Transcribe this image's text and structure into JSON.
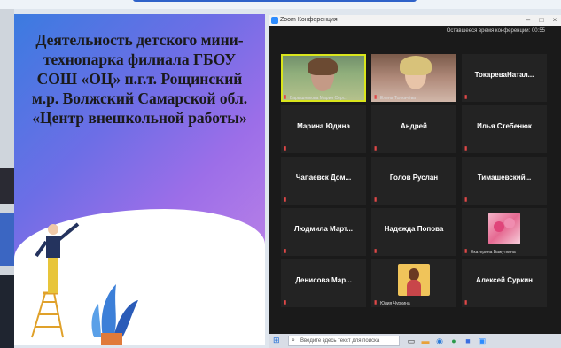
{
  "slide": {
    "title": "Деятельность детского мини-технопарка филиала ГБОУ СОШ «ОЦ» п.г.т. Рощинский м.р. Волжский Самарской обл. «Центр внешкольной работы»"
  },
  "zoom": {
    "window_title": "Zoom Конференция",
    "meeting_timer": "Оставшееся время конференции: 00:55",
    "tiles": [
      {
        "name": "",
        "caption": "Барышникова Мария Серг...",
        "kind": "video1"
      },
      {
        "name": "",
        "caption": "Елена Толкачёва",
        "kind": "video2"
      },
      {
        "name": "ТокареваНатал...",
        "caption": "",
        "kind": "name"
      },
      {
        "name": "Марина Юдина",
        "caption": "",
        "kind": "name"
      },
      {
        "name": "Андрей",
        "caption": "",
        "kind": "name"
      },
      {
        "name": "Илья Стебенюк",
        "caption": "",
        "kind": "name"
      },
      {
        "name": "Чапаевск Дом...",
        "caption": "",
        "kind": "name"
      },
      {
        "name": "Голов Руслан",
        "caption": "",
        "kind": "name"
      },
      {
        "name": "Тимашевский...",
        "caption": "",
        "kind": "name"
      },
      {
        "name": "Людмила Март...",
        "caption": "",
        "kind": "name"
      },
      {
        "name": "Надежда Попова",
        "caption": "",
        "kind": "name"
      },
      {
        "name": "",
        "caption": "Екатерина Бажуткина",
        "kind": "avatar-roses"
      },
      {
        "name": "Денисова Мар...",
        "caption": "",
        "kind": "name"
      },
      {
        "name": "",
        "caption": "Юлия Чуркина",
        "kind": "avatar-person"
      },
      {
        "name": "Алексей Суркин",
        "caption": "",
        "kind": "name"
      }
    ]
  },
  "taskbar": {
    "search_placeholder": "Введите здесь текст для поиска"
  },
  "colors": {
    "accent_active_speaker": "#d9e51c",
    "muted_mic": "#e04848",
    "zoom_bg": "#1a1a1a",
    "tile_bg": "#232323"
  }
}
